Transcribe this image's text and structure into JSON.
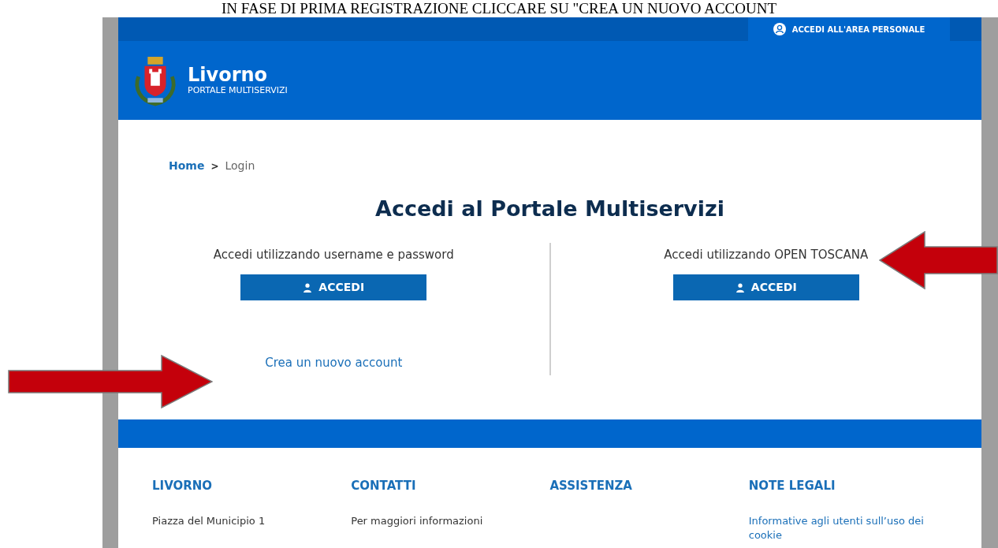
{
  "caption": "IN FASE DI PRIMA REGISTRAZIONE CLICCARE SU \"CREA UN NUOVO ACCOUNT",
  "top_bar": {
    "personal_area_button": "ACCEDI ALL'AREA PERSONALE"
  },
  "header": {
    "title": "Livorno",
    "subtitle": "PORTALE MULTISERVIZI"
  },
  "breadcrumb": [
    {
      "label": "Home",
      "kind": "link"
    },
    {
      "label": ">",
      "kind": "separator"
    },
    {
      "label": "Login",
      "kind": "current"
    }
  ],
  "heading": "Accedi al Portale Multiservizi",
  "login_options": [
    {
      "label": "Accedi utilizzando username e password",
      "button": "ACCEDI",
      "link": "Crea un nuovo account"
    },
    {
      "label": "Accedi utilizzando OPEN TOSCANA",
      "button": "ACCEDI"
    }
  ],
  "footer": {
    "columns": [
      {
        "heading": "LIVORNO",
        "text": "Piazza del Municipio 1",
        "kind": "plain"
      },
      {
        "heading": "CONTATTI",
        "text": "Per maggiori informazioni",
        "kind": "plain"
      },
      {
        "heading": "ASSISTENZA"
      },
      {
        "heading": "NOTE LEGALI",
        "text": "Informative agli utenti sull’uso dei cookie",
        "kind": "link"
      }
    ]
  }
}
